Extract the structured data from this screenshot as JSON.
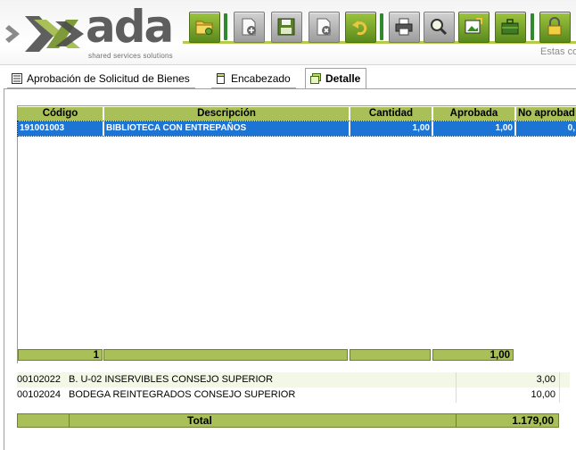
{
  "brand": {
    "name": "ada",
    "tagline": "shared services solutions",
    "accent_color": "#a9bf58",
    "selection_color": "#1c74d4"
  },
  "toolbar": {
    "buttons": [
      {
        "name": "open-folder-button",
        "icon": "folder-icon"
      },
      {
        "name": "new-record-button",
        "icon": "new-document-icon"
      },
      {
        "name": "save-button",
        "icon": "floppy-disk-icon"
      },
      {
        "name": "delete-button",
        "icon": "delete-document-icon"
      },
      {
        "name": "undo-button",
        "icon": "undo-arrow-icon"
      },
      {
        "name": "print-button",
        "icon": "printer-icon"
      },
      {
        "name": "search-button",
        "icon": "magnifier-icon"
      },
      {
        "name": "export-button",
        "icon": "export-picture-icon"
      },
      {
        "name": "briefcase-button",
        "icon": "briefcase-icon"
      },
      {
        "name": "lock-button",
        "icon": "padlock-icon"
      }
    ],
    "status_text": "Estas co"
  },
  "tabs": [
    {
      "label": "Aprobación de Solicitud de Bienes",
      "icon": "list-icon",
      "active": false
    },
    {
      "label": "Encabezado",
      "icon": "document-icon",
      "active": false
    },
    {
      "label": "Detalle",
      "icon": "detail-icon",
      "active": true
    }
  ],
  "detail_grid": {
    "columns": [
      "Código",
      "Descripción",
      "Cantidad",
      "Aprobada",
      "No aprobad"
    ],
    "rows": [
      {
        "codigo": "191001003",
        "descripcion": "BIBLIOTECA CON ENTREPAÑOS",
        "cantidad": "1,00",
        "aprobada": "1,00",
        "no_aprobada": "0,"
      }
    ],
    "summary": {
      "count": "1",
      "aprobada_total": "1,00"
    }
  },
  "warehouse_list": {
    "rows": [
      {
        "code": "00102022",
        "description": "B.  U-02  INSERVIBLES CONSEJO SUPERIOR",
        "quantity": "3,00"
      },
      {
        "code": "00102024",
        "description": "BODEGA REINTEGRADOS CONSEJO SUPERIOR",
        "quantity": "10,00"
      }
    ],
    "total_label": "Total",
    "total_value": "1.179,00"
  }
}
